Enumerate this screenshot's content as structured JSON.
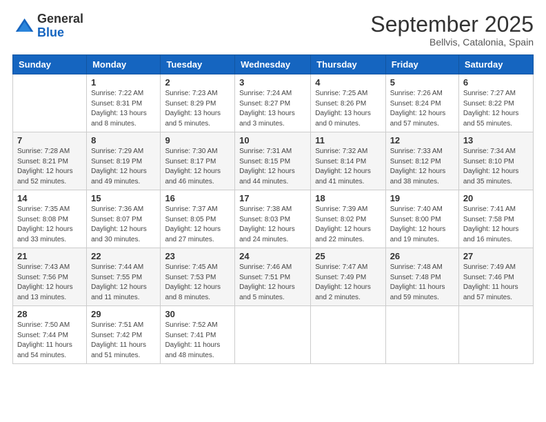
{
  "header": {
    "logo": {
      "general": "General",
      "blue": "Blue"
    },
    "title": "September 2025",
    "location": "Bellvis, Catalonia, Spain"
  },
  "weekdays": [
    "Sunday",
    "Monday",
    "Tuesday",
    "Wednesday",
    "Thursday",
    "Friday",
    "Saturday"
  ],
  "weeks": [
    [
      {
        "day": "",
        "info": ""
      },
      {
        "day": "1",
        "info": "Sunrise: 7:22 AM\nSunset: 8:31 PM\nDaylight: 13 hours\nand 8 minutes."
      },
      {
        "day": "2",
        "info": "Sunrise: 7:23 AM\nSunset: 8:29 PM\nDaylight: 13 hours\nand 5 minutes."
      },
      {
        "day": "3",
        "info": "Sunrise: 7:24 AM\nSunset: 8:27 PM\nDaylight: 13 hours\nand 3 minutes."
      },
      {
        "day": "4",
        "info": "Sunrise: 7:25 AM\nSunset: 8:26 PM\nDaylight: 13 hours\nand 0 minutes."
      },
      {
        "day": "5",
        "info": "Sunrise: 7:26 AM\nSunset: 8:24 PM\nDaylight: 12 hours\nand 57 minutes."
      },
      {
        "day": "6",
        "info": "Sunrise: 7:27 AM\nSunset: 8:22 PM\nDaylight: 12 hours\nand 55 minutes."
      }
    ],
    [
      {
        "day": "7",
        "info": "Sunrise: 7:28 AM\nSunset: 8:21 PM\nDaylight: 12 hours\nand 52 minutes."
      },
      {
        "day": "8",
        "info": "Sunrise: 7:29 AM\nSunset: 8:19 PM\nDaylight: 12 hours\nand 49 minutes."
      },
      {
        "day": "9",
        "info": "Sunrise: 7:30 AM\nSunset: 8:17 PM\nDaylight: 12 hours\nand 46 minutes."
      },
      {
        "day": "10",
        "info": "Sunrise: 7:31 AM\nSunset: 8:15 PM\nDaylight: 12 hours\nand 44 minutes."
      },
      {
        "day": "11",
        "info": "Sunrise: 7:32 AM\nSunset: 8:14 PM\nDaylight: 12 hours\nand 41 minutes."
      },
      {
        "day": "12",
        "info": "Sunrise: 7:33 AM\nSunset: 8:12 PM\nDaylight: 12 hours\nand 38 minutes."
      },
      {
        "day": "13",
        "info": "Sunrise: 7:34 AM\nSunset: 8:10 PM\nDaylight: 12 hours\nand 35 minutes."
      }
    ],
    [
      {
        "day": "14",
        "info": "Sunrise: 7:35 AM\nSunset: 8:08 PM\nDaylight: 12 hours\nand 33 minutes."
      },
      {
        "day": "15",
        "info": "Sunrise: 7:36 AM\nSunset: 8:07 PM\nDaylight: 12 hours\nand 30 minutes."
      },
      {
        "day": "16",
        "info": "Sunrise: 7:37 AM\nSunset: 8:05 PM\nDaylight: 12 hours\nand 27 minutes."
      },
      {
        "day": "17",
        "info": "Sunrise: 7:38 AM\nSunset: 8:03 PM\nDaylight: 12 hours\nand 24 minutes."
      },
      {
        "day": "18",
        "info": "Sunrise: 7:39 AM\nSunset: 8:02 PM\nDaylight: 12 hours\nand 22 minutes."
      },
      {
        "day": "19",
        "info": "Sunrise: 7:40 AM\nSunset: 8:00 PM\nDaylight: 12 hours\nand 19 minutes."
      },
      {
        "day": "20",
        "info": "Sunrise: 7:41 AM\nSunset: 7:58 PM\nDaylight: 12 hours\nand 16 minutes."
      }
    ],
    [
      {
        "day": "21",
        "info": "Sunrise: 7:43 AM\nSunset: 7:56 PM\nDaylight: 12 hours\nand 13 minutes."
      },
      {
        "day": "22",
        "info": "Sunrise: 7:44 AM\nSunset: 7:55 PM\nDaylight: 12 hours\nand 11 minutes."
      },
      {
        "day": "23",
        "info": "Sunrise: 7:45 AM\nSunset: 7:53 PM\nDaylight: 12 hours\nand 8 minutes."
      },
      {
        "day": "24",
        "info": "Sunrise: 7:46 AM\nSunset: 7:51 PM\nDaylight: 12 hours\nand 5 minutes."
      },
      {
        "day": "25",
        "info": "Sunrise: 7:47 AM\nSunset: 7:49 PM\nDaylight: 12 hours\nand 2 minutes."
      },
      {
        "day": "26",
        "info": "Sunrise: 7:48 AM\nSunset: 7:48 PM\nDaylight: 11 hours\nand 59 minutes."
      },
      {
        "day": "27",
        "info": "Sunrise: 7:49 AM\nSunset: 7:46 PM\nDaylight: 11 hours\nand 57 minutes."
      }
    ],
    [
      {
        "day": "28",
        "info": "Sunrise: 7:50 AM\nSunset: 7:44 PM\nDaylight: 11 hours\nand 54 minutes."
      },
      {
        "day": "29",
        "info": "Sunrise: 7:51 AM\nSunset: 7:42 PM\nDaylight: 11 hours\nand 51 minutes."
      },
      {
        "day": "30",
        "info": "Sunrise: 7:52 AM\nSunset: 7:41 PM\nDaylight: 11 hours\nand 48 minutes."
      },
      {
        "day": "",
        "info": ""
      },
      {
        "day": "",
        "info": ""
      },
      {
        "day": "",
        "info": ""
      },
      {
        "day": "",
        "info": ""
      }
    ]
  ]
}
